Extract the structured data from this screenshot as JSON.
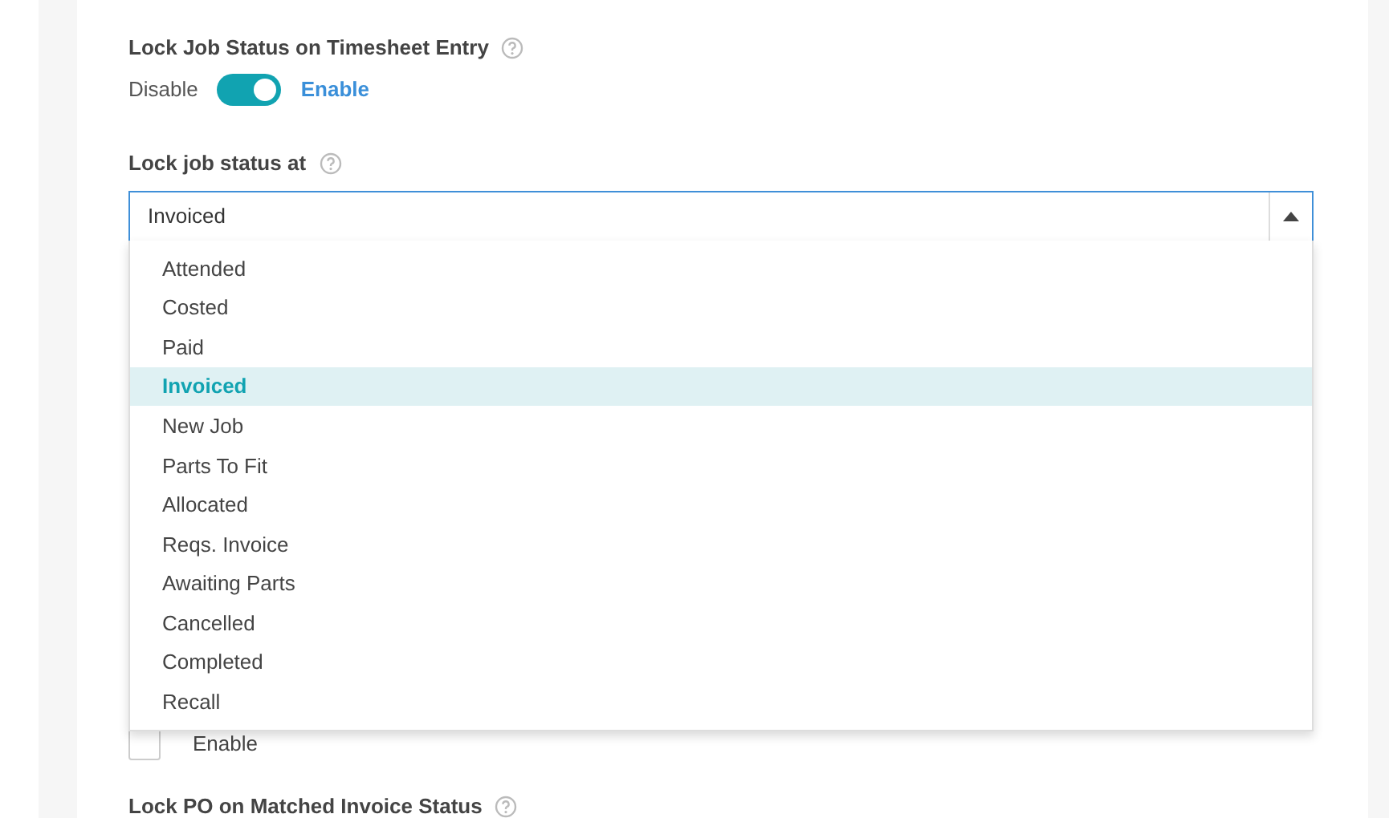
{
  "lock_job_status": {
    "label": "Lock Job Status on Timesheet Entry",
    "toggle": {
      "off_label": "Disable",
      "on_label": "Enable",
      "on": true
    }
  },
  "lock_job_status_at": {
    "label": "Lock job status at",
    "value": "Invoiced",
    "expanded": true,
    "options": [
      {
        "label": "Attended",
        "selected": false
      },
      {
        "label": "Costed",
        "selected": false
      },
      {
        "label": "Paid",
        "selected": false
      },
      {
        "label": "Invoiced",
        "selected": true
      },
      {
        "label": "New Job",
        "selected": false
      },
      {
        "label": "Parts To Fit",
        "selected": false
      },
      {
        "label": "Allocated",
        "selected": false
      },
      {
        "label": "Reqs. Invoice",
        "selected": false
      },
      {
        "label": "Awaiting Parts",
        "selected": false
      },
      {
        "label": "Cancelled",
        "selected": false
      },
      {
        "label": "Completed",
        "selected": false
      },
      {
        "label": "Recall",
        "selected": false
      }
    ]
  },
  "enable_checkbox": {
    "label": "Enable",
    "checked": false
  },
  "lock_po": {
    "label": "Lock PO on Matched Invoice Status"
  }
}
